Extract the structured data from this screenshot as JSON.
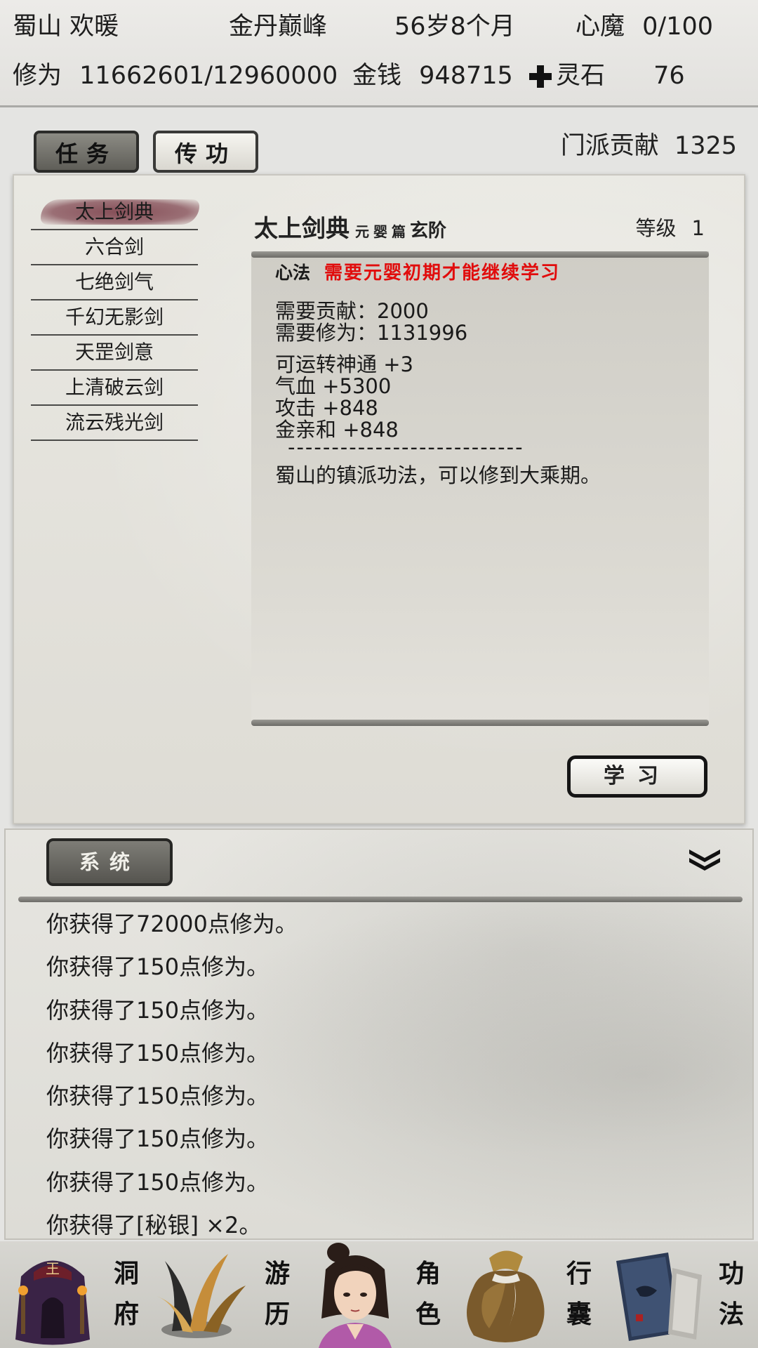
{
  "header": {
    "sect": "蜀山",
    "name": "欢暖",
    "realm": "金丹巅峰",
    "age": "56岁8个月",
    "heart_demon_label": "心魔",
    "heart_demon_value": "0/100",
    "cultivation_label": "修为",
    "cultivation_value": "11662601/12960000",
    "money_label": "金钱",
    "money_value": "948715",
    "spirit_stone_label": "灵石",
    "spirit_stone_value": "76"
  },
  "tabs": [
    {
      "label": "任务",
      "active": true
    },
    {
      "label": "传功",
      "active": false
    }
  ],
  "contribution": {
    "label": "门派贡献",
    "value": "1325"
  },
  "technique_list": [
    {
      "label": "太上剑典",
      "selected": true
    },
    {
      "label": "六合剑"
    },
    {
      "label": "七绝剑气"
    },
    {
      "label": "千幻无影剑"
    },
    {
      "label": "天罡剑意"
    },
    {
      "label": "上清破云剑"
    },
    {
      "label": "流云残光剑"
    }
  ],
  "detail": {
    "title": "太上剑典",
    "chapter": "元婴篇",
    "grade": "玄阶",
    "level_label": "等级",
    "level_value": "1",
    "type_label": "心法",
    "requirement_warning": "需要元婴初期才能继续学习",
    "need_contribution": "需要贡献：2000",
    "need_cultivation": "需要修为：1131996",
    "bonuses": [
      "可运转神通 +3",
      "气血 +5300",
      "攻击 +848",
      "金亲和 +848"
    ],
    "separator": "---------------------------",
    "description": "蜀山的镇派功法，可以修到大乘期。",
    "learn_button": "学习"
  },
  "log": {
    "tab_label": "系统",
    "messages": [
      "你获得了72000点修为。",
      "你获得了150点修为。",
      "你获得了150点修为。",
      "你获得了150点修为。",
      "你获得了150点修为。",
      "你获得了150点修为。",
      "你获得了150点修为。",
      "你获得了[秘银] ×2。"
    ]
  },
  "bottom_nav": [
    {
      "label": "洞府",
      "icon": "cave-mansion-icon"
    },
    {
      "label": "游历",
      "icon": "grass-travel-icon"
    },
    {
      "label": "角色",
      "icon": "character-portrait-icon"
    },
    {
      "label": "行囊",
      "icon": "bag-icon"
    },
    {
      "label": "功法",
      "icon": "scroll-books-icon"
    }
  ],
  "colors": {
    "warning": "#e10c0c",
    "selected_highlight": "#80465a"
  }
}
